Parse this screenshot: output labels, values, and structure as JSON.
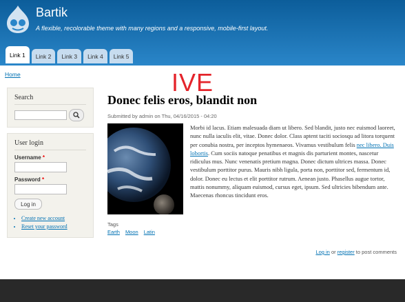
{
  "header": {
    "site_name": "Bartik",
    "slogan": "A flexible, recolorable theme with many regions and a responsive, mobile-first layout.",
    "logo_icon": "drupal-drop-icon"
  },
  "tabs": [
    {
      "label": "Link 1",
      "active": true
    },
    {
      "label": "Link 2"
    },
    {
      "label": "Link 3"
    },
    {
      "label": "Link 4"
    },
    {
      "label": "Link 5"
    }
  ],
  "breadcrumb": {
    "home": "Home"
  },
  "overlay": {
    "text": "IVE",
    "color": "#e4242b"
  },
  "sidebar": {
    "search": {
      "title": "Search",
      "button_icon": "search-icon"
    },
    "login": {
      "title": "User login",
      "username_label": "Username",
      "password_label": "Password",
      "required_mark": "*",
      "button": "Log in",
      "create_account": "Create new account",
      "reset_password": "Reset your password"
    }
  },
  "node": {
    "title": "Donec felis eros, blandit non",
    "submitted": "Submitted by admin on Thu, 04/16/2015 - 04:20",
    "body_before_link": "Morbi id lacus. Etiam malesuada diam ut libero. Sed blandit, justo nec euismod laoreet, nunc nulla iaculis elit, vitae. Donec dolor. Class aptent taciti sociosqu ad litora torquent per conubia nostra, per inceptos hymenaeos. Vivamus vestibulum felis ",
    "body_link": "nec libero. Duis lobortis",
    "body_after_link": ". Cum sociis natoque penatibus et magnis dis parturient montes, nascetur ridiculus mus. Nunc venenatis pretium magna. Donec dictum ultrices massa. Donec vestibulum porttitor purus. Mauris nibh ligula, porta non, porttitor sed, fermentum id, dolor. Donec eu lectus et elit porttitor rutrum. Aenean justo. Phasellus augue tortor, mattis nonummy, aliquam euismod, cursus eget, ipsum. Sed ultricies bibendum ante. Maecenas rhoncus tincidunt eros.",
    "tags_label": "Tags",
    "tags": [
      "Earth",
      "Moon",
      "Latin"
    ],
    "links": {
      "login": "Log in",
      "or": " or ",
      "register": "register",
      "suffix": " to post comments"
    }
  },
  "colors": {
    "header_top": "#0c5d9a",
    "header_bottom": "#2a86c9",
    "link": "#0071b3",
    "footer": "#292929"
  }
}
